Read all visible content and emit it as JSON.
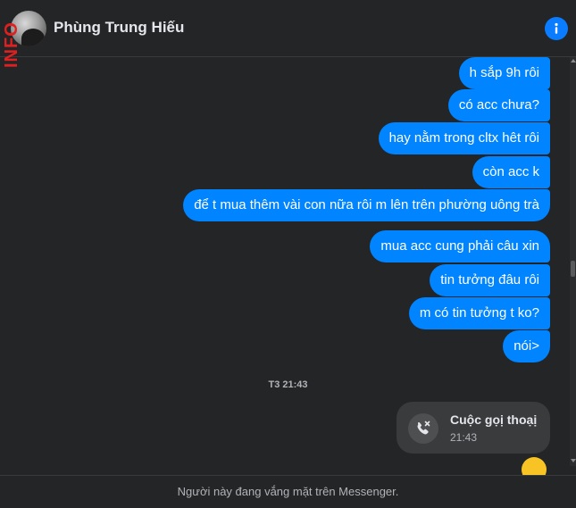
{
  "header": {
    "contact_name": "Phùng Trung Hiếu",
    "watermark": "INFO"
  },
  "messages": [
    {
      "text": "h sắp 9h rôi"
    },
    {
      "text": "có acc chưa?"
    },
    {
      "text": "hay nằm trong cltx hêt rôi"
    },
    {
      "text": "còn acc k"
    },
    {
      "text": "để t mua thêm vài con nữa rôi m lên trên phường uông trà"
    },
    {
      "text": "mua acc cung phải câu xin"
    },
    {
      "text": "tin tưởng đâu rôi"
    },
    {
      "text": "m có tin tưởng t ko?"
    },
    {
      "text": "nói>"
    }
  ],
  "timestamp": "T3 21:43",
  "call": {
    "title": "Cuộc gọị thoạị",
    "time": "21:43"
  },
  "footer": {
    "status": "Người này đang vắng mặt trên Messenger."
  },
  "colors": {
    "background": "#242526",
    "bubble": "#0084ff",
    "accent": "#0a7cff"
  },
  "icons": [
    "info-icon",
    "missed-call-icon"
  ]
}
